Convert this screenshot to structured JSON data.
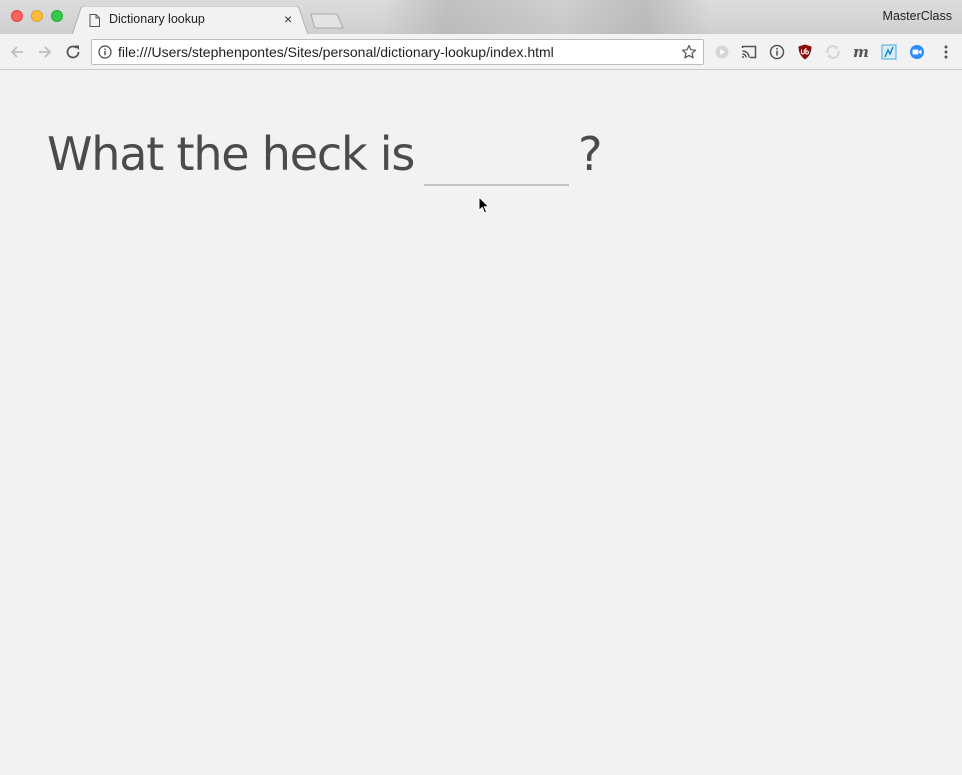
{
  "window": {
    "profile_name": "MasterClass"
  },
  "tab": {
    "title": "Dictionary lookup",
    "close_glyph": "×"
  },
  "toolbar": {
    "url": "file:///Users/stephenpontes/Sites/personal/dictionary-lookup/index.html",
    "extensions": [
      "play-circle-icon",
      "cast-icon",
      "info-circle-icon",
      "ublock-shield-icon",
      "sync-arrows-icon",
      "m-letter-icon",
      "chart-icon",
      "zoom-video-icon"
    ]
  },
  "page": {
    "question_lead": "What the heck is",
    "word_value": "",
    "question_mark": "?"
  },
  "colors": {
    "page_background": "#f2f2f2",
    "heading_text": "#4b4b4b",
    "input_underline": "#c3c3c3",
    "ublock_red": "#8b0d0d",
    "zoom_blue": "#2d8cff"
  }
}
